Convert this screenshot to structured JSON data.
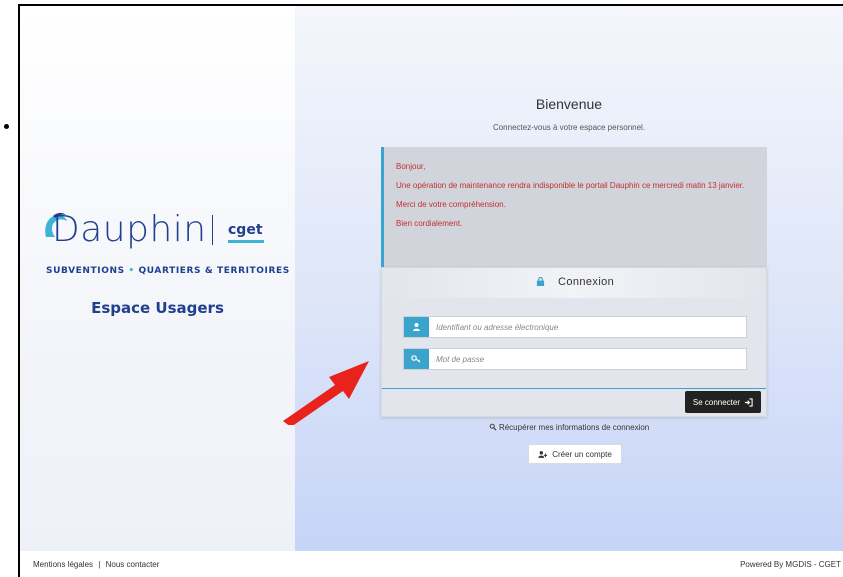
{
  "branding": {
    "logo_word": "Dauphin",
    "logo_partner": "cget",
    "tagline_left": "SUBVENTIONS",
    "tagline_right": "QUARTIERS & TERRITOIRES",
    "tagline_dot": "•",
    "space_title": "Espace Usagers"
  },
  "welcome": {
    "title": "Bienvenue",
    "subtitle": "Connectez-vous à votre espace personnel."
  },
  "notice": {
    "lines": [
      "Bonjour,",
      "Une opération de maintenance rendra indisponible le portail Dauphin ce mercredi matin 13 janvier.",
      " Merci de votre compréhension.",
      "Bien cordialement."
    ]
  },
  "login": {
    "title": "Connexion",
    "identifier_placeholder": "Identifiant ou adresse électronique",
    "password_placeholder": "Mot de passe",
    "submit_label": "Se connecter"
  },
  "links": {
    "recover": "Récupérer mes informations de connexion",
    "create_account": "Créer un compte"
  },
  "footer": {
    "legal": "Mentions légales",
    "separator": "|",
    "contact": "Nous contacter",
    "powered": "Powered By MGDIS - CGET"
  },
  "colors": {
    "brand": "#1f3f8f",
    "accent": "#3aa4cc",
    "notice_text": "#c0302e",
    "annotation_arrow": "#e8231b"
  },
  "icons": {
    "login": "lock-icon",
    "identifier": "user-icon",
    "password": "key-icon",
    "submit": "sign-in-icon",
    "recover": "key-search-icon",
    "create": "user-plus-icon"
  }
}
